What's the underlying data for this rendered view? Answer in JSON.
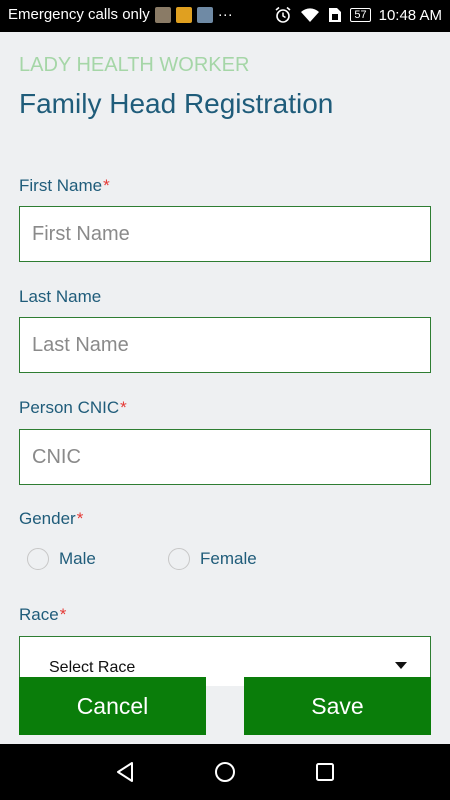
{
  "status_bar": {
    "carrier_text": "Emergency calls only",
    "more_indicator": "···",
    "battery_level": "57",
    "time": "10:48 AM",
    "icons": [
      "photo-notification-icon",
      "notes-notification-icon",
      "gallery-notification-icon",
      "alarm-icon",
      "wifi-icon",
      "sim-icon",
      "battery-icon"
    ]
  },
  "header": {
    "subtitle": "LADY HEALTH WORKER",
    "title": "Family Head Registration"
  },
  "form": {
    "first_name": {
      "label": "First Name",
      "required_mark": "*",
      "placeholder": "First Name",
      "value": ""
    },
    "last_name": {
      "label": "Last Name",
      "placeholder": "Last Name",
      "value": ""
    },
    "cnic": {
      "label": "Person CNIC",
      "required_mark": "*",
      "placeholder": "CNIC",
      "value": ""
    },
    "gender": {
      "label": "Gender",
      "required_mark": "*",
      "options": [
        "Male",
        "Female"
      ],
      "selected": null
    },
    "race": {
      "label": "Race",
      "required_mark": "*",
      "selected_text": "Select Race"
    }
  },
  "buttons": {
    "cancel": "Cancel",
    "save": "Save"
  },
  "colors": {
    "accent_green": "#0a7d0a",
    "border_green": "#2e7d32",
    "title_blue": "#1f5c7a",
    "subtitle_green": "#a5d6a7",
    "required_red": "#e53935"
  }
}
